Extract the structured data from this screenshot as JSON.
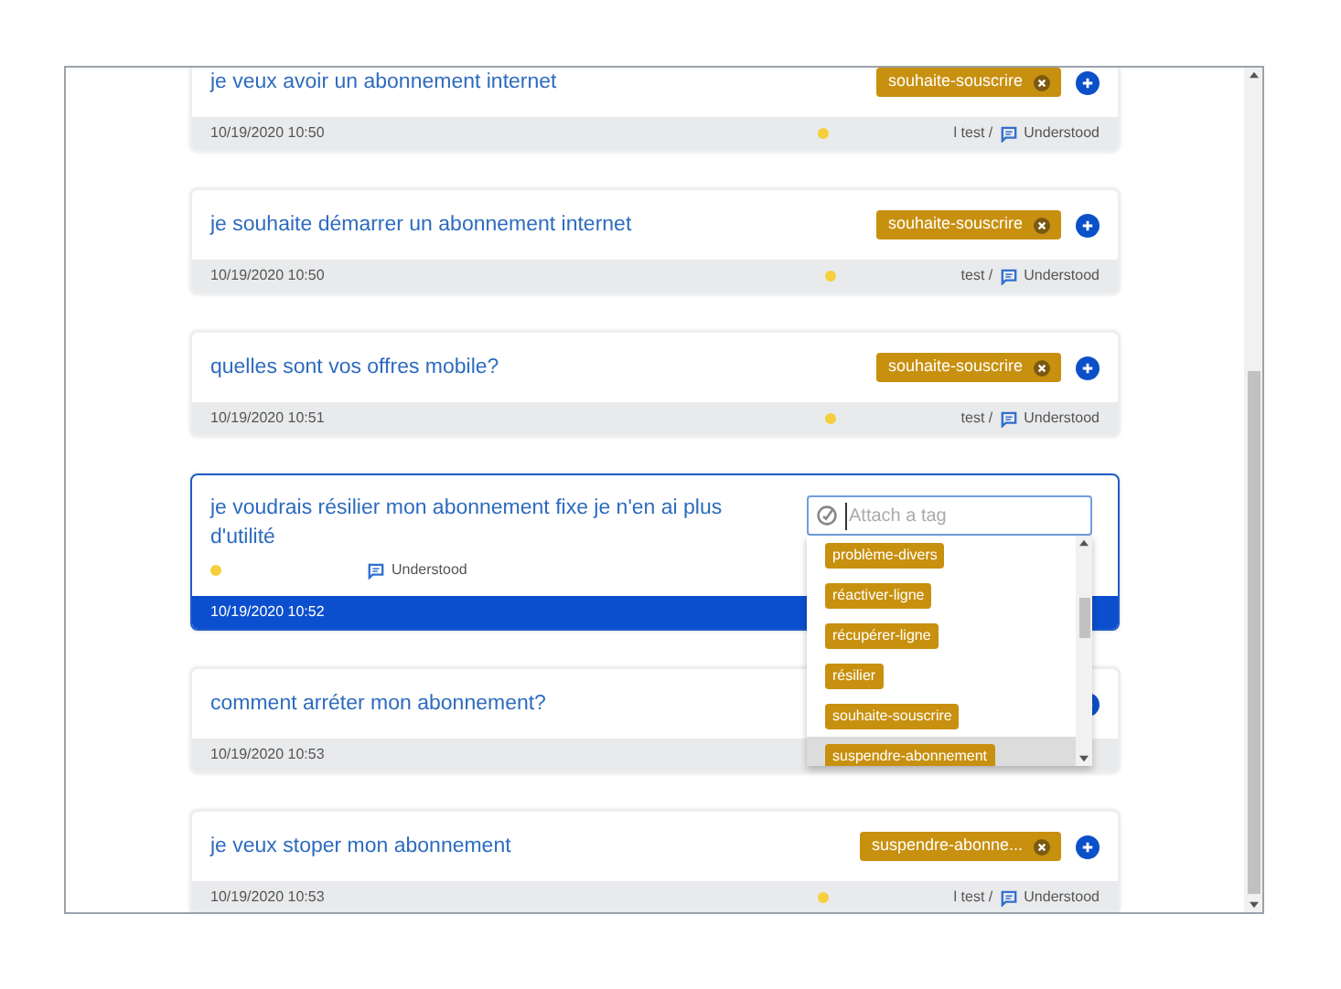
{
  "cards": [
    {
      "text": "je veux avoir un abonnement internet",
      "tags": [
        "souhaite-souscrire"
      ],
      "date": "10/19/2020 10:50",
      "user": "l test /",
      "status": "Understood",
      "selected": false
    },
    {
      "text": "je souhaite démarrer un abonnement internet",
      "tags": [
        "souhaite-souscrire"
      ],
      "date": "10/19/2020 10:50",
      "user": "test /",
      "status": "Understood",
      "selected": false
    },
    {
      "text": "quelles sont vos offres mobile?",
      "tags": [
        "souhaite-souscrire"
      ],
      "date": "10/19/2020 10:51",
      "user": "test /",
      "status": "Understood",
      "selected": false
    },
    {
      "text": "je voudrais résilier mon abonnement fixe je n'en ai plus d'utilité",
      "date": "10/19/2020 10:52",
      "status": "Understood",
      "selected": true
    },
    {
      "text": "comment arréter mon abonnement?",
      "date": "10/19/2020 10:53",
      "selected": false
    },
    {
      "text": "je veux stoper mon abonnement",
      "tags": [
        "suspendre-abonne..."
      ],
      "date": "10/19/2020 10:53",
      "user": "l test /",
      "status": "Understood",
      "selected": false
    }
  ],
  "tag_picker": {
    "placeholder": "Attach a tag",
    "options": [
      {
        "label": "problème-divers",
        "selected": false
      },
      {
        "label": "réactiver-ligne",
        "selected": false
      },
      {
        "label": "récupérer-ligne",
        "selected": false
      },
      {
        "label": "résilier",
        "selected": false
      },
      {
        "label": "souhaite-souscrire",
        "selected": false
      },
      {
        "label": "suspendre-abonnement",
        "selected": true
      }
    ]
  }
}
